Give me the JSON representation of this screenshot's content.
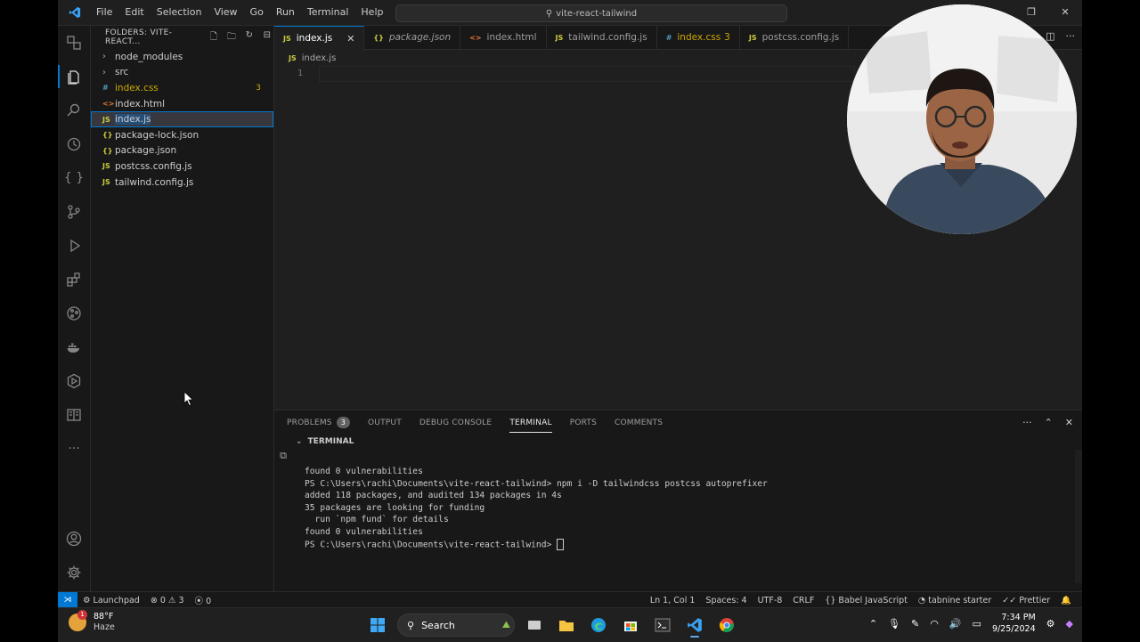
{
  "window": {
    "title": "vite-react-tailwind"
  },
  "menu": [
    "File",
    "Edit",
    "Selection",
    "View",
    "Go",
    "Run",
    "Terminal",
    "Help"
  ],
  "explorer": {
    "header": "FOLDERS: VITE-REACT...",
    "items": [
      {
        "label": "node_modules",
        "type": "folder",
        "icon": "chevron-right-icon"
      },
      {
        "label": "src",
        "type": "folder",
        "icon": "chevron-right-icon"
      },
      {
        "label": "index.css",
        "type": "css",
        "icon_glyph": "#",
        "badge": "3"
      },
      {
        "label": "index.html",
        "type": "html",
        "icon_glyph": "<>"
      },
      {
        "label": "index.js",
        "type": "js",
        "icon_glyph": "JS",
        "selected": true
      },
      {
        "label": "package-lock.json",
        "type": "json",
        "icon_glyph": "{}"
      },
      {
        "label": "package.json",
        "type": "json",
        "icon_glyph": "{}"
      },
      {
        "label": "postcss.config.js",
        "type": "js",
        "icon_glyph": "JS"
      },
      {
        "label": "tailwind.config.js",
        "type": "js",
        "icon_glyph": "JS"
      }
    ]
  },
  "tabs": [
    {
      "label": "index.js",
      "icon_glyph": "JS",
      "close": "✕"
    },
    {
      "label": "package.json",
      "icon_glyph": "{}"
    },
    {
      "label": "index.html",
      "icon_glyph": "<>"
    },
    {
      "label": "tailwind.config.js",
      "icon_glyph": "JS"
    },
    {
      "label": "index.css",
      "icon_glyph": "#",
      "count": "3"
    },
    {
      "label": "postcss.config.js",
      "icon_glyph": "JS"
    }
  ],
  "breadcrumb": {
    "icon_glyph": "JS",
    "label": "index.js"
  },
  "editor": {
    "line_number": "1"
  },
  "panel": {
    "tabs": [
      "PROBLEMS",
      "OUTPUT",
      "DEBUG CONSOLE",
      "TERMINAL",
      "PORTS",
      "COMMENTS"
    ],
    "problems_count": "3",
    "terminal_header": "TERMINAL",
    "terminal_lines": [
      "",
      "found 0 vulnerabilities",
      "PS C:\\Users\\rachi\\Documents\\vite-react-tailwind> npm i -D tailwindcss postcss autoprefixer",
      "",
      "added 118 packages, and audited 134 packages in 4s",
      "",
      "35 packages are looking for funding",
      "  run `npm fund` for details",
      "",
      "found 0 vulnerabilities"
    ],
    "prompt": "PS C:\\Users\\rachi\\Documents\\vite-react-tailwind> "
  },
  "statusbar": {
    "launchpad": "Launchpad",
    "errors": "0",
    "warnings": "3",
    "ports": "0",
    "position": "Ln 1, Col 1",
    "spaces": "Spaces: 4",
    "encoding": "UTF-8",
    "eol": "CRLF",
    "language": "Babel JavaScript",
    "tabnine": "tabnine starter",
    "prettier": "Prettier"
  },
  "taskbar": {
    "temperature": "88°F",
    "weather": "Haze",
    "weather_badge": "1",
    "search_label": "Search",
    "time": "7:34 PM",
    "date": "9/25/2024"
  },
  "colors": {
    "accent": "#0078d4",
    "background": "#1f1f1f",
    "sidebar": "#181818",
    "warning": "#cca700"
  }
}
